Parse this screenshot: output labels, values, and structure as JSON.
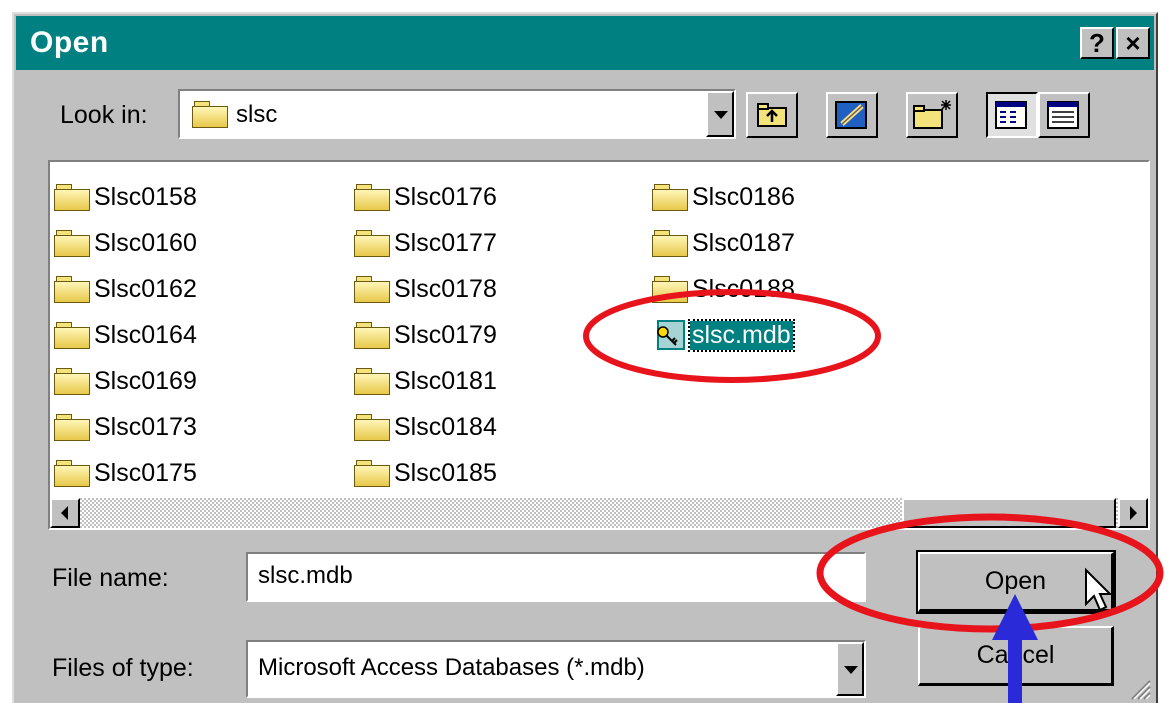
{
  "window": {
    "title": "Open",
    "help_label": "?",
    "close_label": "×"
  },
  "look_in": {
    "label": "Look in:",
    "value": "slsc"
  },
  "toolbar": {
    "icons": [
      "up-one-level-icon",
      "desktop-icon",
      "new-folder-icon",
      "list-view-icon",
      "details-view-icon"
    ]
  },
  "files": {
    "col1": [
      "Slsc0158",
      "Slsc0160",
      "Slsc0162",
      "Slsc0164",
      "Slsc0169",
      "Slsc0173",
      "Slsc0175"
    ],
    "col2": [
      "Slsc0176",
      "Slsc0177",
      "Slsc0178",
      "Slsc0179",
      "Slsc0181",
      "Slsc0184",
      "Slsc0185"
    ],
    "col3": [
      "Slsc0186",
      "Slsc0187",
      "Slsc0188"
    ],
    "selected_file": "slsc.mdb"
  },
  "form": {
    "file_name_label": "File name:",
    "file_name_value": "slsc.mdb",
    "file_type_label": "Files of type:",
    "file_type_value": "Microsoft Access Databases (*.mdb)"
  },
  "buttons": {
    "open": "Open",
    "cancel": "Cancel"
  },
  "annotations": {
    "circle_color": "#e8141c",
    "arrow_color": "#2a2ad8"
  },
  "colors": {
    "title_bar": "#008080",
    "selection": "#008080",
    "dialog_face": "#c0c0c0"
  }
}
